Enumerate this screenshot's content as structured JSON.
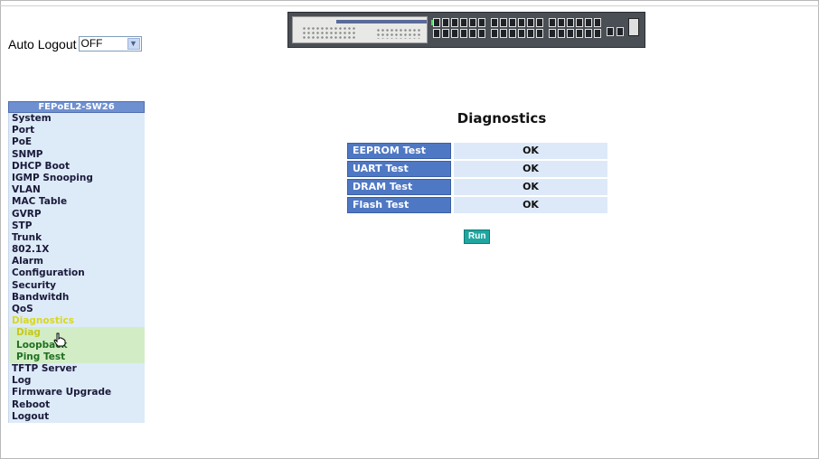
{
  "header": {
    "auto_logout_label": "Auto Logout",
    "auto_logout_value": "OFF"
  },
  "sidebar": {
    "title": "FEPoEL2-SW26",
    "items": [
      {
        "label": "System"
      },
      {
        "label": "Port"
      },
      {
        "label": "PoE"
      },
      {
        "label": "SNMP"
      },
      {
        "label": "DHCP Boot"
      },
      {
        "label": "IGMP Snooping"
      },
      {
        "label": "VLAN"
      },
      {
        "label": "MAC Table"
      },
      {
        "label": "GVRP"
      },
      {
        "label": "STP"
      },
      {
        "label": "Trunk"
      },
      {
        "label": "802.1X"
      },
      {
        "label": "Alarm"
      },
      {
        "label": "Configuration"
      },
      {
        "label": "Security"
      },
      {
        "label": "Bandwitdh"
      },
      {
        "label": "QoS"
      },
      {
        "label": "Diagnostics"
      }
    ],
    "sub_items": [
      {
        "label": "Diag"
      },
      {
        "label": "Loopback"
      },
      {
        "label": "Ping Test"
      }
    ],
    "items_after": [
      {
        "label": "TFTP Server"
      },
      {
        "label": "Log"
      },
      {
        "label": "Firmware Upgrade"
      },
      {
        "label": "Reboot"
      },
      {
        "label": "Logout"
      }
    ]
  },
  "main": {
    "title": "Diagnostics",
    "tests": [
      {
        "name": "EEPROM Test",
        "result": "OK"
      },
      {
        "name": "UART Test",
        "result": "OK"
      },
      {
        "name": "DRAM Test",
        "result": "OK"
      },
      {
        "name": "Flash Test",
        "result": "OK"
      }
    ],
    "run_label": "Run"
  },
  "colors": {
    "menu_header": "#6f90d0",
    "menu_item_bg": "#ddeaf8",
    "submenu_bg": "#d2edc6",
    "active_text": "#d8d820",
    "test_label_bg": "#4f78c4",
    "result_bg": "#dde9f8",
    "run_button": "#20a6a0"
  },
  "icons": {
    "dropdown": "chevron-down-icon",
    "cursor": "hand-pointer-icon"
  }
}
